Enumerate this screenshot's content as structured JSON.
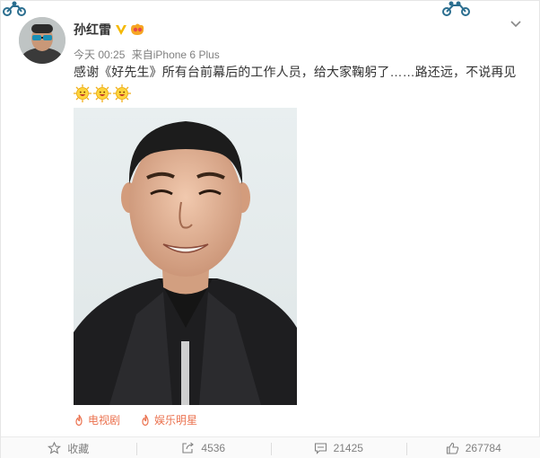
{
  "post": {
    "author": "孙红雷",
    "time": "今天 00:25",
    "source_prefix": "来自",
    "source": "iPhone 6 Plus",
    "text": "感谢《好先生》所有台前幕后的工作人员，给大家鞠躬了……路还远，不说再见",
    "emojis": [
      "smile-emoji",
      "smile-emoji",
      "smile-emoji"
    ]
  },
  "tags": [
    {
      "label": "电视剧",
      "icon": "flame-icon"
    },
    {
      "label": "娱乐明星",
      "icon": "flame-icon"
    }
  ],
  "actions": {
    "favorite_label": "收藏",
    "repost_count": "4536",
    "comment_count": "21425",
    "like_count": "267784"
  },
  "colors": {
    "accent_orange": "#eb7350",
    "verified_gold": "#f5b800",
    "text_gray": "#808080"
  }
}
